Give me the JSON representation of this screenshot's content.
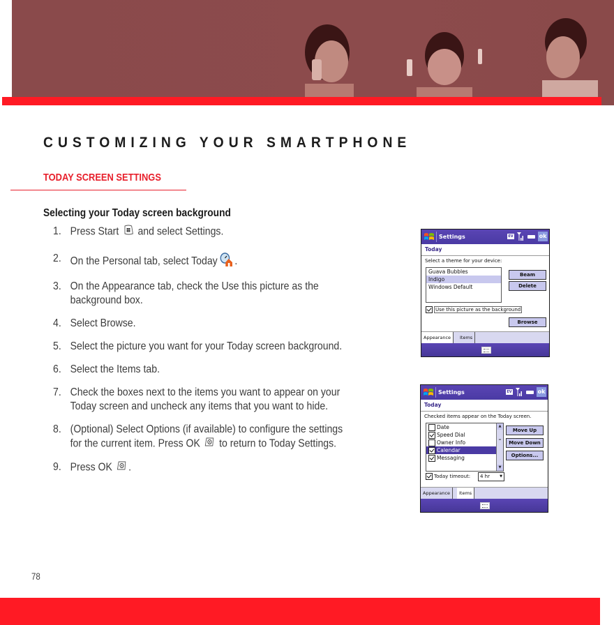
{
  "header": {
    "banner_image": "three-young-men-with-phones-photo",
    "accent_color": "#ff1a24",
    "banner_tint": "#8a4a4b"
  },
  "chapter_title": "CUSTOMIZING YOUR SMARTPHONE",
  "section_title": "TODAY SCREEN SETTINGS",
  "subsection_title": "Selecting your Today screen background",
  "steps": [
    {
      "num": "1.",
      "before": "Press Start",
      "icon": "start-key-icon",
      "after": "and select Settings."
    },
    {
      "num": "2.",
      "before": "On the Personal tab, select Today",
      "icon": "today-settings-icon",
      "after": "."
    },
    {
      "num": "3.",
      "line1": "On the Appearance tab, check the Use this picture as the",
      "line2": "background box."
    },
    {
      "num": "4.",
      "text": "Select Browse."
    },
    {
      "num": "5.",
      "text": "Select the picture you want for your Today screen background."
    },
    {
      "num": "6.",
      "text": "Select the Items tab."
    },
    {
      "num": "7.",
      "line1": "Check the boxes next to the items you want to appear on your",
      "line2": "Today screen and uncheck any items that you want to hide."
    },
    {
      "num": "8.",
      "line1": "(Optional) Select Options (if available) to configure the settings",
      "line2_before": "for the current item. Press OK",
      "icon": "ok-key-icon",
      "line2_after": "to return to Today Settings."
    },
    {
      "num": "9.",
      "before": "Press OK",
      "icon": "ok-key-icon",
      "after": "."
    }
  ],
  "screen_appearance": {
    "title": "Settings",
    "status_badge": "EV",
    "ok_label": "ok",
    "subtitle": "Today",
    "prompt": "Select a theme for your device:",
    "themes": [
      "Guava Bubbles",
      "Indigo",
      "Windows Default"
    ],
    "selected_theme": "Indigo",
    "buttons": {
      "beam": "Beam",
      "delete": "Delete",
      "browse": "Browse"
    },
    "use_picture": {
      "label": "Use this picture as the background",
      "checked": true
    },
    "tabs": [
      "Appearance",
      "Items"
    ],
    "active_tab": "Appearance"
  },
  "screen_items": {
    "title": "Settings",
    "status_badge": "EV",
    "ok_label": "ok",
    "subtitle": "Today",
    "prompt": "Checked items appear on the Today screen.",
    "items": [
      {
        "label": "Date",
        "checked": false
      },
      {
        "label": "Speed Dial",
        "checked": true
      },
      {
        "label": "Owner Info",
        "checked": false
      },
      {
        "label": "Calendar",
        "checked": true
      },
      {
        "label": "Messaging",
        "checked": true
      }
    ],
    "selected_item": "Calendar",
    "buttons": {
      "move_up": "Move Up",
      "move_down": "Move Down",
      "options": "Options..."
    },
    "timeout": {
      "label": "Today timeout:",
      "checked": true,
      "value": "4 hr"
    },
    "tabs": [
      "Appearance",
      "Items"
    ],
    "active_tab": "Items"
  },
  "footer": {
    "page_number": "78"
  }
}
